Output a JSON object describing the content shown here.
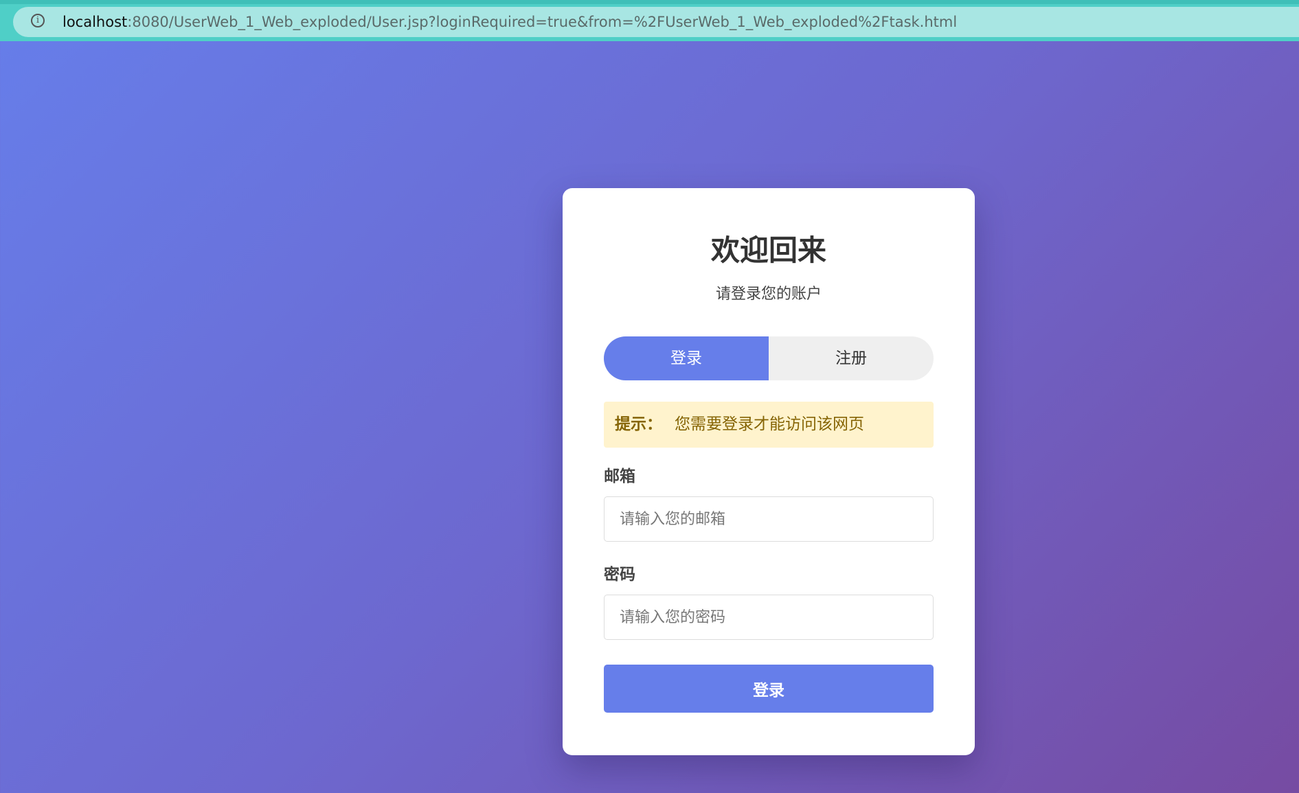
{
  "browser": {
    "url_host": "localhost",
    "url_rest": ":8080/UserWeb_1_Web_exploded/User.jsp?loginRequired=true&from=%2FUserWeb_1_Web_exploded%2Ftask.html",
    "info_icon": "info-circle-icon"
  },
  "card": {
    "title": "欢迎回来",
    "subtitle": "请登录您的账户",
    "tabs": [
      {
        "label": "登录",
        "active": true
      },
      {
        "label": "注册",
        "active": false
      }
    ],
    "notice": {
      "label": "提示：",
      "message": "您需要登录才能访问该网页"
    },
    "email": {
      "label": "邮箱",
      "placeholder": "请输入您的邮箱",
      "value": ""
    },
    "password": {
      "label": "密码",
      "placeholder": "请输入您的密码",
      "value": ""
    },
    "submit_label": "登录"
  },
  "colors": {
    "accent": "#667eea",
    "gradient_start": "#667eea",
    "gradient_end": "#764ba2",
    "notice_bg": "#fff3cd",
    "notice_text": "#856404",
    "browser_bar": "#a8e6e3"
  }
}
